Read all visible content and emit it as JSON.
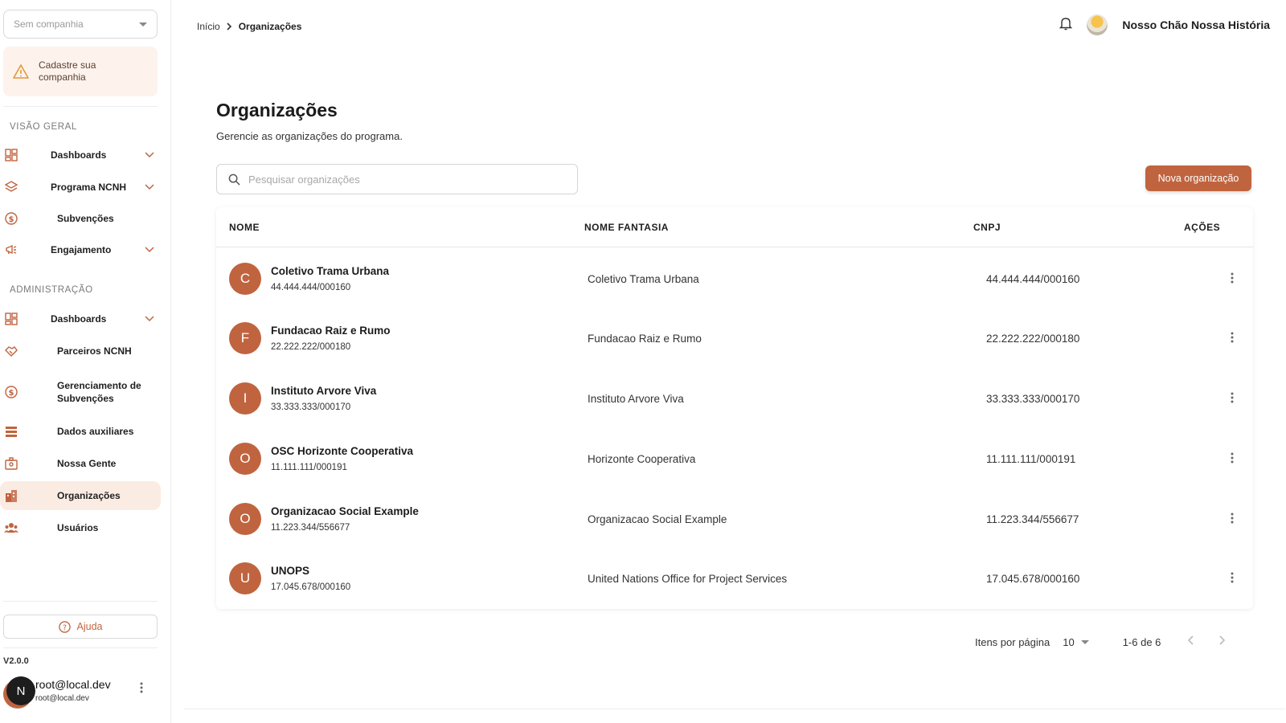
{
  "colors": {
    "accent": "#c0643f",
    "active_bg": "#fbece3"
  },
  "sidebar": {
    "company_select": "Sem companhia",
    "warning": "Cadastre sua companhia",
    "overview_title": "VISÃO GERAL",
    "overview_items": [
      {
        "label": "Dashboards",
        "icon": "grid-icon",
        "expandable": true
      },
      {
        "label": "Programa NCNH",
        "icon": "layers-icon",
        "expandable": true
      },
      {
        "label": "Subvenções",
        "icon": "dollar-coin-icon",
        "expandable": false
      },
      {
        "label": "Engajamento",
        "icon": "megaphone-icon",
        "expandable": true
      }
    ],
    "admin_title": "ADMINISTRAÇÃO",
    "admin_items": [
      {
        "label": "Dashboards",
        "icon": "grid-icon",
        "expandable": true
      },
      {
        "label": "Parceiros NCNH",
        "icon": "handshake-icon",
        "expandable": false
      },
      {
        "label": "Gerenciamento de Subvenções",
        "icon": "dollar-coin-icon",
        "expandable": false
      },
      {
        "label": "Dados auxiliares",
        "icon": "list-icon",
        "expandable": false
      },
      {
        "label": "Nossa Gente",
        "icon": "id-card-icon",
        "expandable": false
      },
      {
        "label": "Organizações",
        "icon": "building-icon",
        "expandable": false,
        "active": true
      },
      {
        "label": "Usuários",
        "icon": "users-icon",
        "expandable": false
      }
    ],
    "help": "Ajuda",
    "version": "V2.0.0",
    "user": {
      "initial": "N",
      "name": "root@local.dev",
      "email": "root@local.dev"
    }
  },
  "header": {
    "breadcrumb_home": "Início",
    "breadcrumb_current": "Organizações",
    "org_name": "Nosso Chão Nossa História"
  },
  "main": {
    "title": "Organizações",
    "subtitle": "Gerencie as organizações do programa.",
    "search_placeholder": "Pesquisar organizações",
    "new_button": "Nova organização",
    "columns": [
      "NOME",
      "NOME FANTASIA",
      "CNPJ",
      "AÇÕES"
    ],
    "rows": [
      {
        "initial": "C",
        "name": "Coletivo Trama Urbana",
        "cnpj": "44.444.444/000160",
        "fantasy": "Coletivo Trama Urbana"
      },
      {
        "initial": "F",
        "name": "Fundacao Raiz e Rumo",
        "cnpj": "22.222.222/000180",
        "fantasy": "Fundacao Raiz e Rumo"
      },
      {
        "initial": "I",
        "name": "Instituto Arvore Viva",
        "cnpj": "33.333.333/000170",
        "fantasy": "Instituto Arvore Viva"
      },
      {
        "initial": "O",
        "name": "OSC Horizonte Cooperativa",
        "cnpj": "11.111.111/000191",
        "fantasy": "Horizonte Cooperativa"
      },
      {
        "initial": "O",
        "name": "Organizacao Social Example",
        "cnpj": "11.223.344/556677",
        "fantasy": "Organizacao Social Example"
      },
      {
        "initial": "U",
        "name": "UNOPS",
        "cnpj": "17.045.678/000160",
        "fantasy": "United Nations Office for Project Services"
      }
    ],
    "pagination": {
      "items_per_page_label": "Itens por página",
      "per_page": "10",
      "range": "1-6 de 6"
    }
  }
}
